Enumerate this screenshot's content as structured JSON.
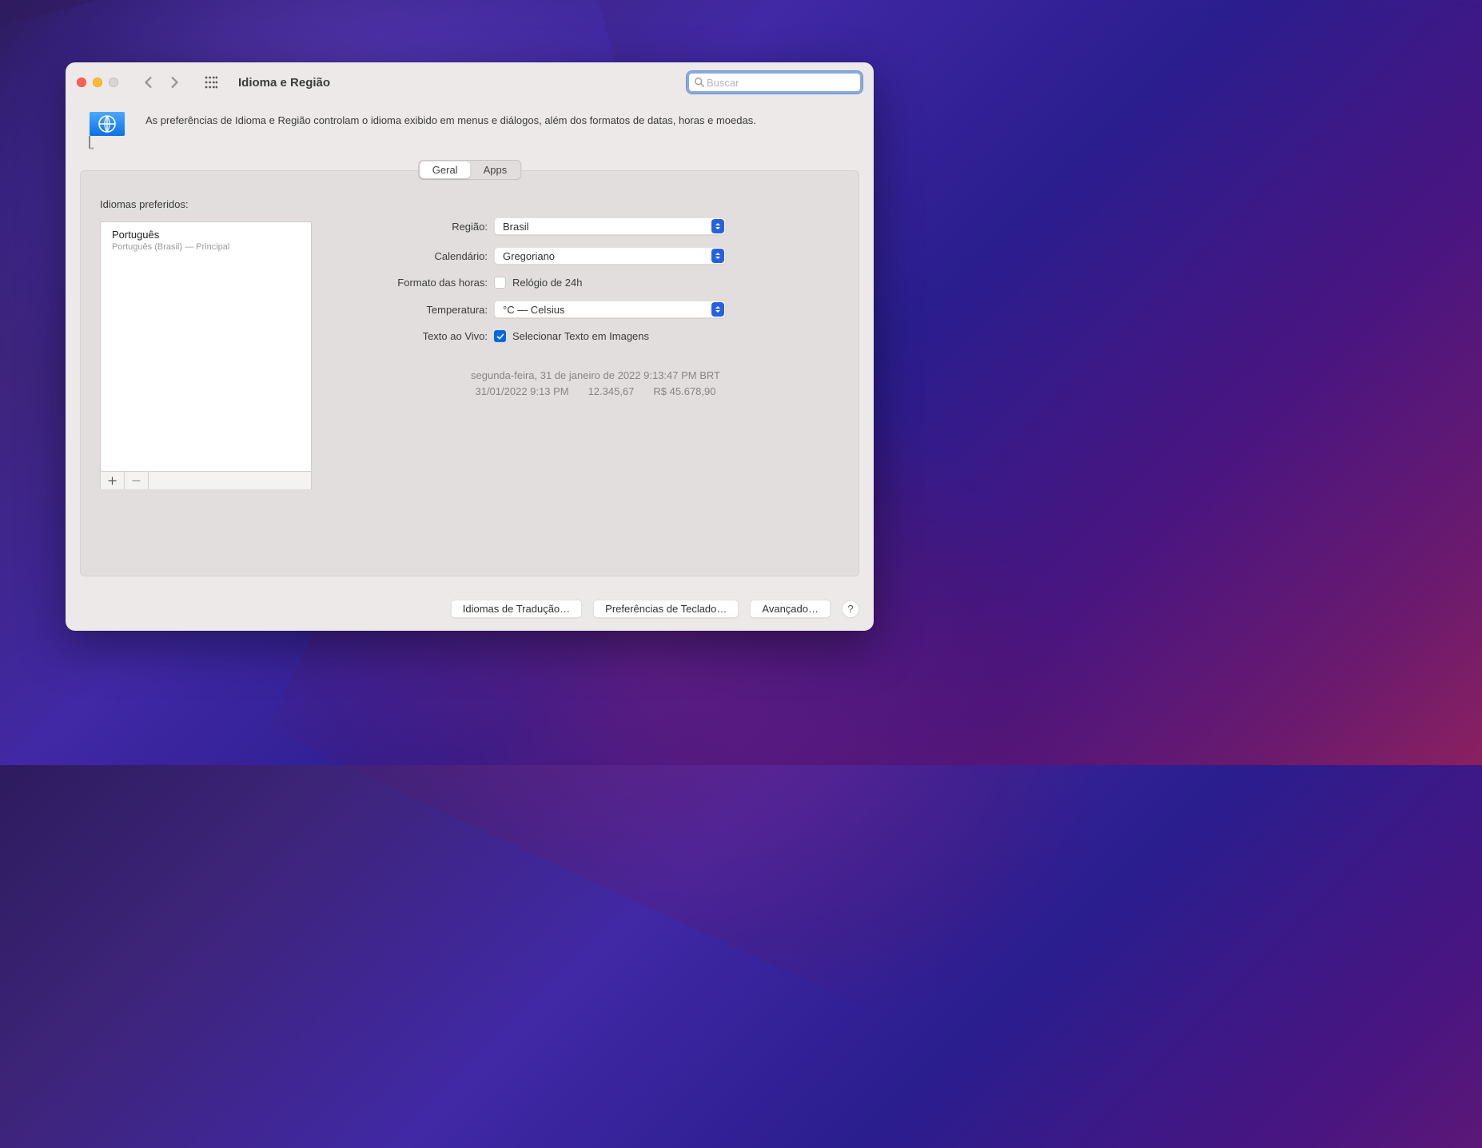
{
  "window": {
    "title": "Idioma e Região",
    "search_placeholder": "Buscar"
  },
  "header": {
    "description": "As preferências de Idioma e Região controlam o idioma exibido em menus e diálogos, além dos formatos de datas, horas e moedas."
  },
  "tabs": {
    "general": "Geral",
    "apps": "Apps"
  },
  "sidebar": {
    "label": "Idiomas preferidos:",
    "items": [
      {
        "name": "Português",
        "sub": "Português (Brasil) — Principal"
      }
    ]
  },
  "form": {
    "region_label": "Região:",
    "region_value": "Brasil",
    "calendar_label": "Calendário:",
    "calendar_value": "Gregoriano",
    "timeformat_label": "Formato das horas:",
    "timeformat_check": "Relógio de 24h",
    "temperature_label": "Temperatura:",
    "temperature_value": "°C — Celsius",
    "livetext_label": "Texto ao Vivo:",
    "livetext_check": "Selecionar Texto em Imagens"
  },
  "sample": {
    "line1": "segunda-feira, 31 de janeiro de 2022 9:13:47 PM BRT",
    "date": "31/01/2022 9:13 PM",
    "number": "12.345,67",
    "currency": "R$ 45.678,90"
  },
  "buttons": {
    "translate": "Idiomas de Tradução…",
    "keyboard": "Preferências de Teclado…",
    "advanced": "Avançado…",
    "help": "?"
  }
}
